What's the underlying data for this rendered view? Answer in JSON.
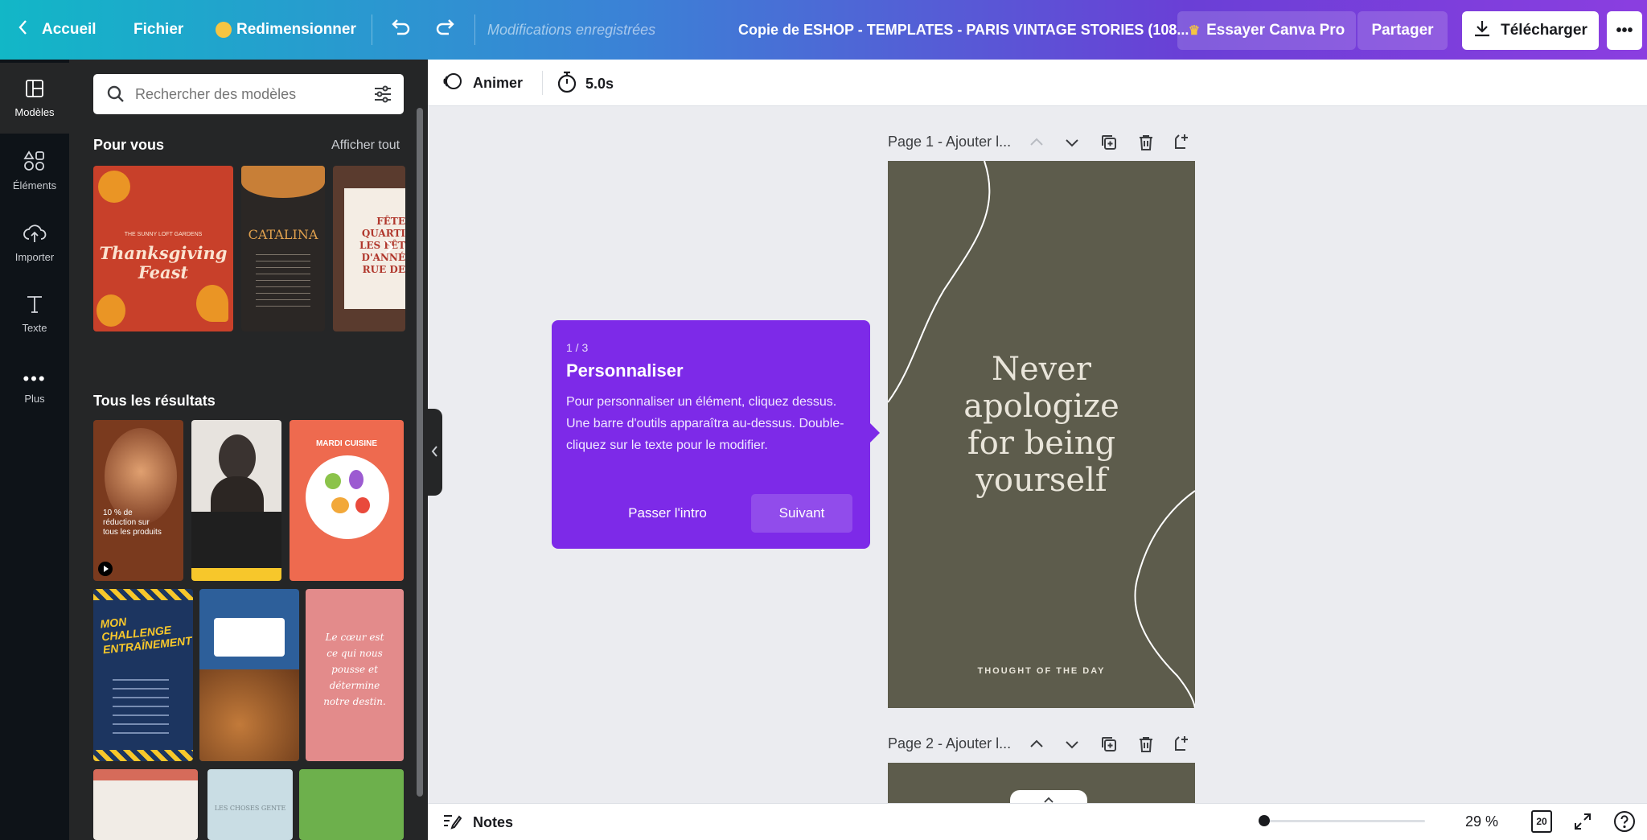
{
  "topbar": {
    "back_label": "Accueil",
    "file_label": "Fichier",
    "resize_label": "Redimensionner",
    "saved_status": "Modifications enregistrées",
    "doc_title": "Copie de ESHOP - TEMPLATES - PARIS VINTAGE STORIES (108...",
    "pro_label": "Essayer Canva Pro",
    "share_label": "Partager",
    "download_label": "Télécharger",
    "more_label": "•••"
  },
  "rail": {
    "items": [
      {
        "label": "Modèles",
        "icon": "templates-icon"
      },
      {
        "label": "Éléments",
        "icon": "elements-icon"
      },
      {
        "label": "Importer",
        "icon": "upload-icon"
      },
      {
        "label": "Texte",
        "icon": "text-icon"
      },
      {
        "label": "Plus",
        "icon": "more-icon"
      }
    ]
  },
  "panel": {
    "search_placeholder": "Rechercher des modèles",
    "for_you_title": "Pour vous",
    "show_all": "Afficher tout",
    "all_results_title": "Tous les résultats",
    "for_you_templates": [
      {
        "line1": "THE SUNNY LOFT GARDENS",
        "line2": "Thanksgiving",
        "line3": "Feast",
        "bg": "#c8402a"
      },
      {
        "line1": "CATALINA",
        "bg": "#2b2725"
      },
      {
        "line1": "FÊTE",
        "line2": "QUARTI",
        "line3": "LES FÊT",
        "line4": "D'ANNÉ",
        "line5": "RUE DE",
        "bg": "#5a3b2e"
      }
    ],
    "results": [
      {
        "text": "10 % de réduction sur tous les produits",
        "bg": "#7a3a1e"
      },
      {
        "text": "",
        "bg": "#1f1f1f"
      },
      {
        "text": "MARDI CUISINE",
        "bg": "#ee6a4f"
      },
      {
        "text": "MON CHALLENGE ENTRAÎNEMENT",
        "bg": "#1c3560"
      },
      {
        "text": "",
        "bg": "#2d5f9a"
      },
      {
        "text": "Le cœur est ce qui nous pousse et détermine notre destin.",
        "bg": "#e38b8b"
      },
      {
        "text": "",
        "bg": "#f1ece6"
      },
      {
        "text": "LES CHOSES GENTE",
        "bg": "#c9dde4"
      },
      {
        "text": "",
        "bg": "#6db04c"
      }
    ]
  },
  "toolbar": {
    "animate_label": "Animer",
    "duration_label": "5.0s"
  },
  "canvas": {
    "page1_title": "Page 1 - Ajouter l...",
    "page2_title": "Page 2 - Ajouter l...",
    "quote_lines": [
      "Never",
      "apologize",
      "for being",
      "yourself"
    ],
    "footer": "THOUGHT OF THE DAY",
    "page_bg": "#5d5c4c"
  },
  "tooltip": {
    "step": "1 / 3",
    "title": "Personnaliser",
    "body": "Pour personnaliser un élément, cliquez dessus. Une barre d'outils apparaîtra au-dessus. Double-cliquez sur le texte pour le modifier.",
    "skip_label": "Passer l'intro",
    "next_label": "Suivant"
  },
  "bottombar": {
    "notes_label": "Notes",
    "zoom_label": "29 %",
    "zoom_fraction": 0.0,
    "page_count": "20"
  },
  "colors": {
    "accent_purple": "#7d2ae8",
    "rail_bg": "#0e1318",
    "panel_bg": "#252627",
    "canvas_bg": "#ebecf0"
  }
}
